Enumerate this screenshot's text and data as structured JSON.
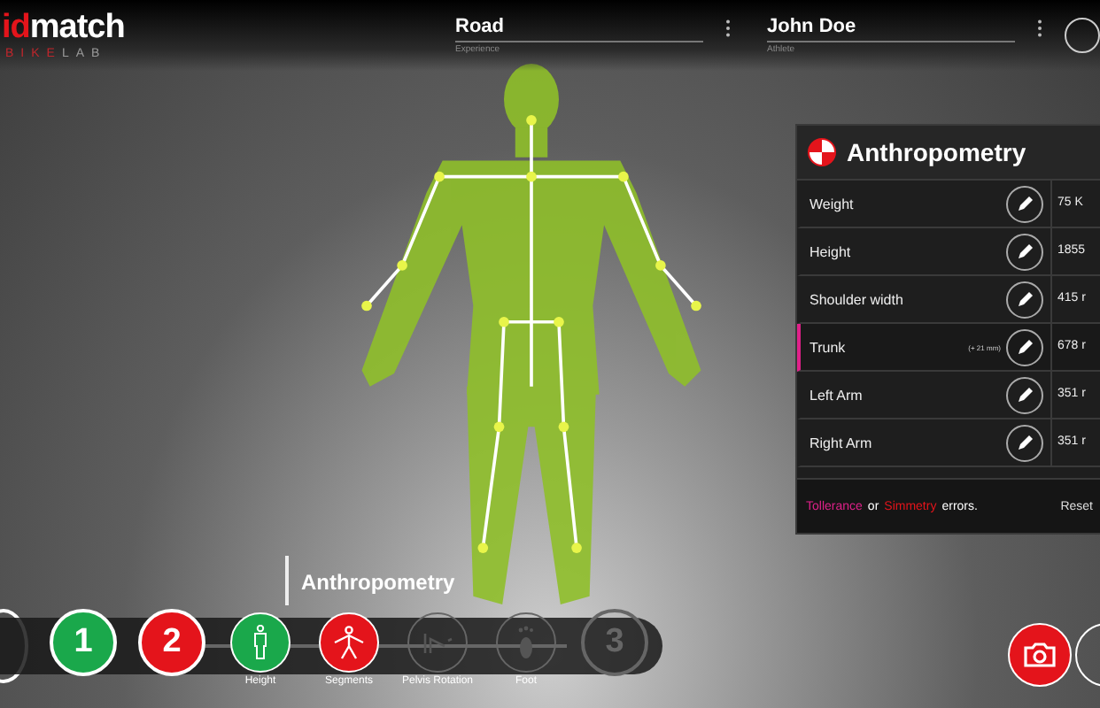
{
  "logo": {
    "brand_accent": "id",
    "brand_main": "match",
    "sub_accent": "BIKE",
    "sub_main": "LAB"
  },
  "header_fields": [
    {
      "value": "Road",
      "label": "Experience"
    },
    {
      "value": "John Doe",
      "label": "Athlete"
    }
  ],
  "panel": {
    "title": "Anthropometry",
    "rows": [
      {
        "label": "Weight",
        "note": "",
        "value": "75 K",
        "highlighted": false
      },
      {
        "label": "Height",
        "note": "",
        "value": "1855",
        "highlighted": false
      },
      {
        "label": "Shoulder width",
        "note": "",
        "value": "415 r",
        "highlighted": false
      },
      {
        "label": "Trunk",
        "note": "(+ 21 mm)",
        "value": "678 r",
        "highlighted": true
      },
      {
        "label": "Left Arm",
        "note": "",
        "value": "351 r",
        "highlighted": false
      },
      {
        "label": "Right Arm",
        "note": "",
        "value": "351 r",
        "highlighted": false
      }
    ],
    "footer_parts": [
      {
        "text": "Tollerance",
        "color": "#e0218a"
      },
      {
        "text": "or",
        "color": "#ffffff"
      },
      {
        "text": "Simmetry",
        "color": "#e4141b"
      },
      {
        "text": "errors.",
        "color": "#ffffff"
      }
    ],
    "reset": "Reset"
  },
  "step_caption": "Anthropometry",
  "steps": [
    {
      "kind": "step",
      "label": "1",
      "completed": true,
      "selected": false
    },
    {
      "kind": "step",
      "label": "2",
      "completed": false,
      "selected": true
    },
    {
      "kind": "sub",
      "label": "Height",
      "completed": true,
      "selected": false
    },
    {
      "kind": "sub",
      "label": "Segments",
      "completed": false,
      "selected": true
    },
    {
      "kind": "sub",
      "label": "Pelvis Rotation",
      "completed": false,
      "selected": false
    },
    {
      "kind": "sub",
      "label": "Foot",
      "completed": false,
      "selected": false
    },
    {
      "kind": "step",
      "label": "3",
      "completed": false,
      "selected": false
    }
  ]
}
